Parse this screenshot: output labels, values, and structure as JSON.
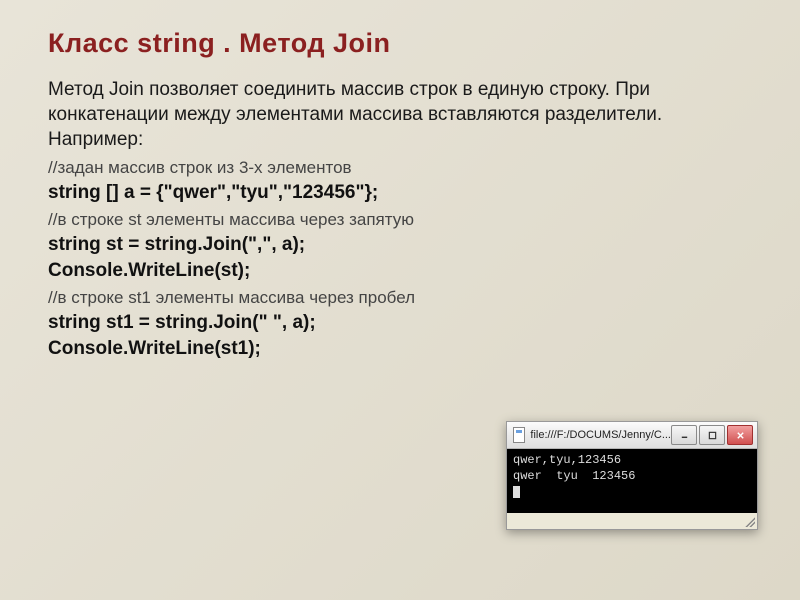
{
  "title": "Класс string . Метод Join",
  "intro": "Метод Join позволяет соединить массив строк в единую строку. При конкатенации между элементами массива вставляются разделители. Например:",
  "lines": {
    "c1": "//задан массив строк из 3-х элементов",
    "l1": "string [] a = {\"qwer\",\"tyu\",\"123456\"};",
    "c2": "//в строке st элементы массива через запятую",
    "l2": "string st = string.Join(\",\", a);",
    "l3": "Console.WriteLine(st);",
    "c3": "//в строке st1 элементы массива через пробел",
    "l4": "string st1 = string.Join(\"  \", a);",
    "l5": "Console.WriteLine(st1);"
  },
  "console": {
    "title": "file:///F:/DOCUMS/Jenny/C...",
    "output1": "qwer,tyu,123456",
    "output2": "qwer  tyu  123456"
  }
}
